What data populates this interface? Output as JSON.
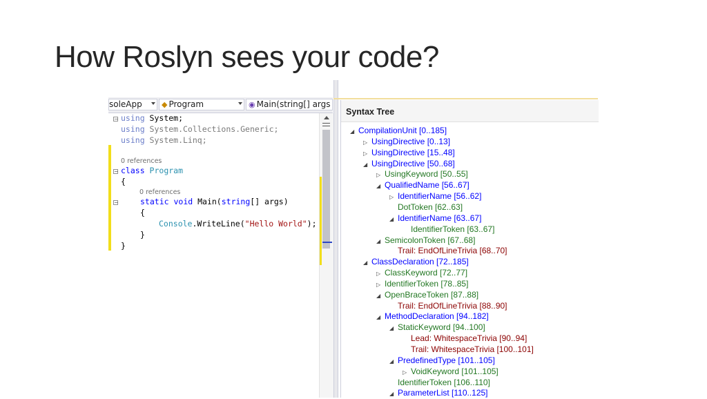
{
  "slide": {
    "title": "How Roslyn sees your code?"
  },
  "editor": {
    "project_dropdown": "soleApp",
    "class_dropdown": "Program",
    "member_dropdown": "Main(string[] args",
    "references_class": "0 references",
    "references_method": "0 references",
    "code": {
      "l1_kw": "using",
      "l1_rest": " System;",
      "l2_kw": "using",
      "l2_rest": " System.Collections.Generic;",
      "l3_kw": "using",
      "l3_rest": " System.Linq;",
      "l4_kw": "class",
      "l4_type": " Program",
      "l5": "{",
      "l6_kw1": "static",
      "l6_kw2": " void",
      "l6_name": " Main(",
      "l6_kw3": "string",
      "l6_rest": "[] args)",
      "l7": "{",
      "l8_type": "Console",
      "l8_mid": ".WriteLine(",
      "l8_str": "\"Hello World\"",
      "l8_end": ");",
      "l9": "}",
      "l10": "}"
    }
  },
  "syntax_tree": {
    "title": "Syntax Tree",
    "nodes": [
      {
        "text": "CompilationUnit [0..185]",
        "kind": "node",
        "glyph": "▲"
      },
      {
        "text": "UsingDirective [0..13]",
        "kind": "node",
        "glyph": "▷"
      },
      {
        "text": "UsingDirective [15..48]",
        "kind": "node",
        "glyph": "▷"
      },
      {
        "text": "UsingDirective [50..68]",
        "kind": "node",
        "glyph": "▲"
      },
      {
        "text": "UsingKeyword [50..55]",
        "kind": "token",
        "glyph": "▷"
      },
      {
        "text": "QualifiedName [56..67]",
        "kind": "node",
        "glyph": "▲"
      },
      {
        "text": "IdentifierName [56..62]",
        "kind": "node",
        "glyph": "▷"
      },
      {
        "text": "DotToken [62..63]",
        "kind": "token",
        "glyph": ""
      },
      {
        "text": "IdentifierName [63..67]",
        "kind": "node",
        "glyph": "▲"
      },
      {
        "text": "IdentifierToken [63..67]",
        "kind": "token",
        "glyph": ""
      },
      {
        "text": "SemicolonToken [67..68]",
        "kind": "token",
        "glyph": "▲"
      },
      {
        "text": "Trail: EndOfLineTrivia [68..70]",
        "kind": "trivia",
        "glyph": ""
      },
      {
        "text": "ClassDeclaration [72..185]",
        "kind": "node",
        "glyph": "▲"
      },
      {
        "text": "ClassKeyword [72..77]",
        "kind": "token",
        "glyph": "▷"
      },
      {
        "text": "IdentifierToken [78..85]",
        "kind": "token",
        "glyph": "▷"
      },
      {
        "text": "OpenBraceToken [87..88]",
        "kind": "token",
        "glyph": "▲"
      },
      {
        "text": "Trail: EndOfLineTrivia [88..90]",
        "kind": "trivia",
        "glyph": ""
      },
      {
        "text": "MethodDeclaration [94..182]",
        "kind": "node",
        "glyph": "▲"
      },
      {
        "text": "StaticKeyword [94..100]",
        "kind": "token",
        "glyph": "▲"
      },
      {
        "text": "Lead: WhitespaceTrivia [90..94]",
        "kind": "trivia",
        "glyph": ""
      },
      {
        "text": "Trail: WhitespaceTrivia [100..101]",
        "kind": "trivia",
        "glyph": ""
      },
      {
        "text": "PredefinedType [101..105]",
        "kind": "node",
        "glyph": "▲"
      },
      {
        "text": "VoidKeyword [101..105]",
        "kind": "token",
        "glyph": "▷"
      },
      {
        "text": "IdentifierToken [106..110]",
        "kind": "token",
        "glyph": ""
      },
      {
        "text": "ParameterList [110..125]",
        "kind": "node",
        "glyph": "▲"
      }
    ]
  }
}
